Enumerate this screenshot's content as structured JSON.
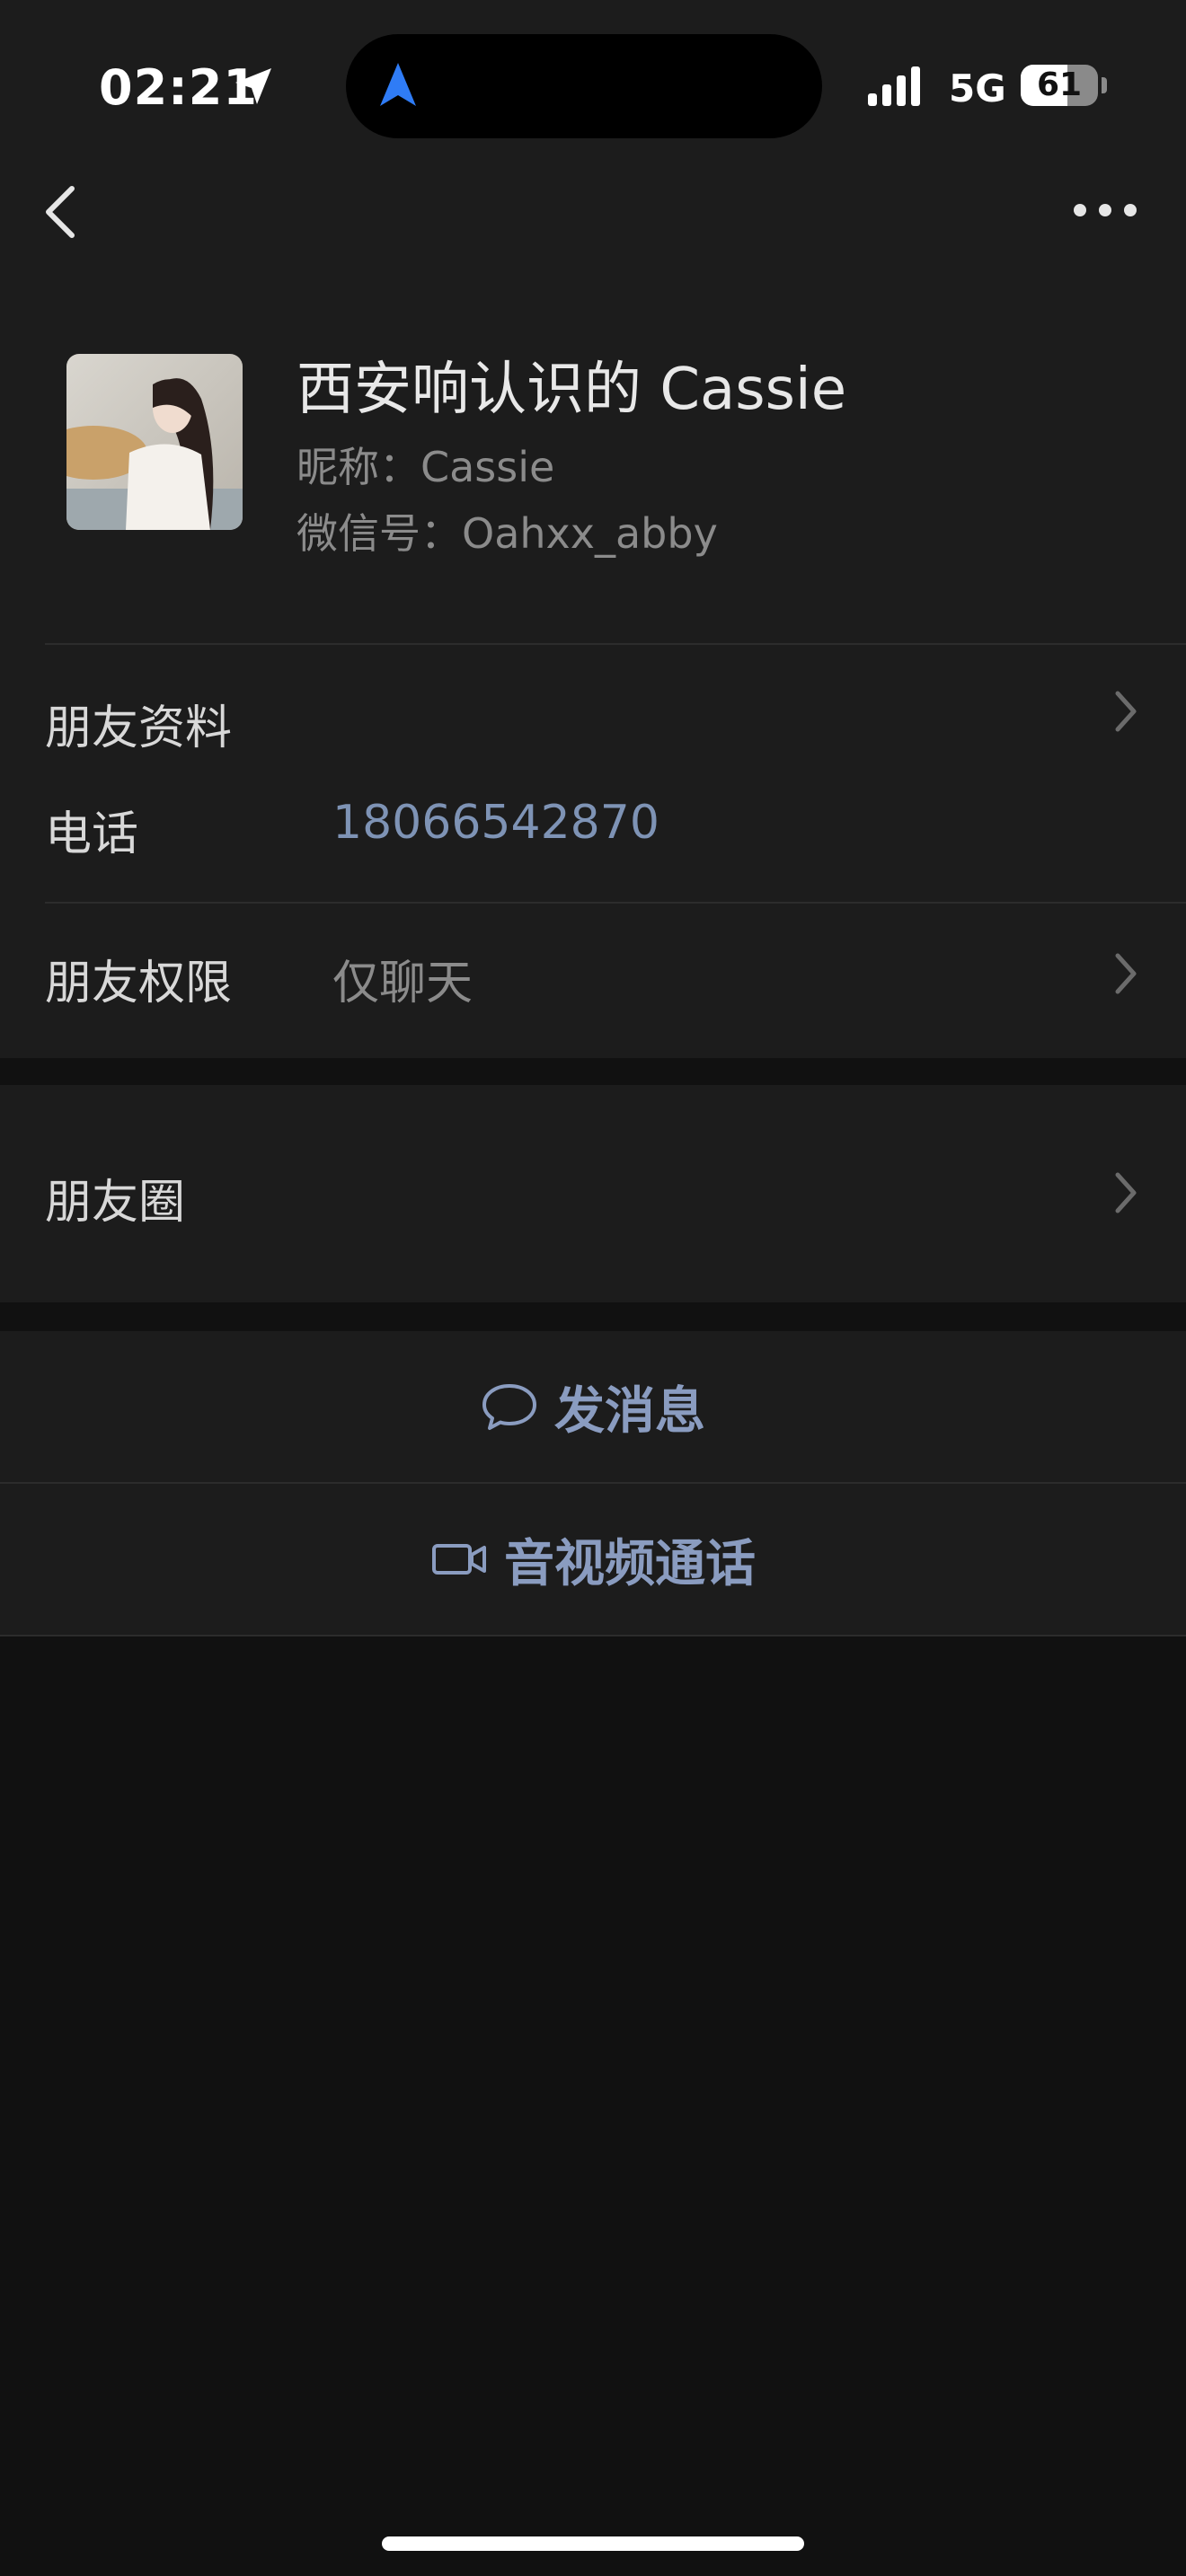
{
  "status_bar": {
    "time": "02:21",
    "network": "5G",
    "battery_text": "61",
    "battery_level": 0.61,
    "icons": [
      "location-arrow-icon",
      "navigation-icon",
      "signal-icon",
      "battery-icon"
    ]
  },
  "nav": {
    "back_icon": "chevron-left-icon",
    "more_icon": "more-dots-icon"
  },
  "profile": {
    "remark_name": "西安响认识的 Cassie",
    "nickname": "昵称：Cassie",
    "wechat_id": "微信号：Oahxx_abby"
  },
  "info": {
    "friend_profile_label": "朋友资料",
    "phone_label": "电话",
    "phone_value": "18066542870",
    "permission_label": "朋友权限",
    "permission_value": "仅聊天"
  },
  "moments": {
    "label": "朋友圈"
  },
  "actions": {
    "send_message": "发消息",
    "av_call": "音视频通话"
  },
  "colors": {
    "background": "#111111",
    "card": "#1c1c1c",
    "link": "#8a9cc0",
    "phone": "#7e93b5",
    "secondary_text": "#8b8b8b"
  }
}
